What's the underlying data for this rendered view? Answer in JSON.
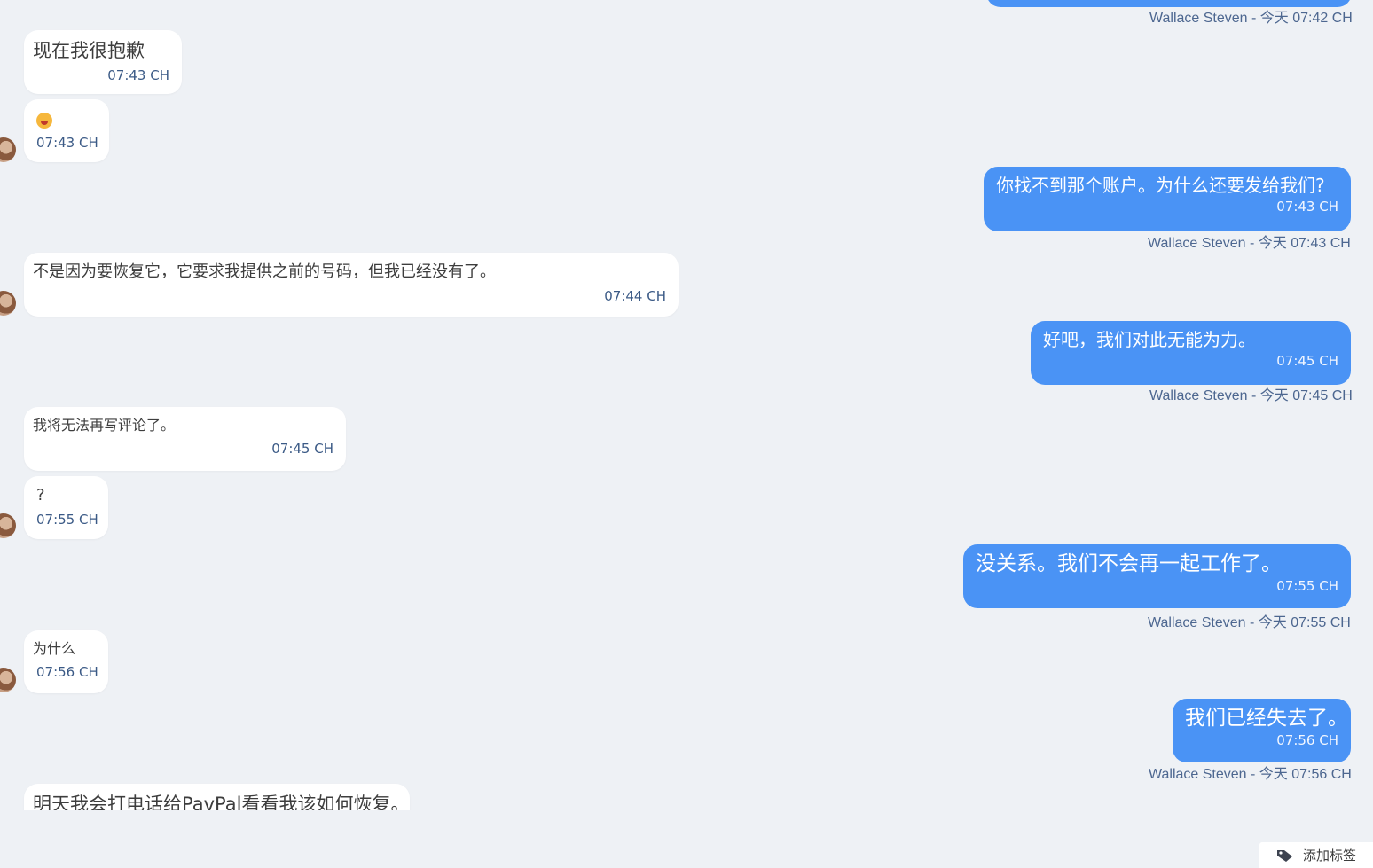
{
  "messages": [
    {
      "id": "m0",
      "direction": "out",
      "meta": "Wallace Steven - 今天 07:42 CH"
    },
    {
      "id": "m1",
      "direction": "in",
      "text": "现在我很抱歉",
      "time": "07:43 CH"
    },
    {
      "id": "m2",
      "direction": "in",
      "emoji": "face-emoji",
      "time": "07:43 CH"
    },
    {
      "id": "m3",
      "direction": "out",
      "text": "你找不到那个账户。为什么还要发给我们?",
      "time": "07:43 CH",
      "meta": "Wallace Steven - 今天 07:43 CH"
    },
    {
      "id": "m4",
      "direction": "in",
      "text": "不是因为要恢复它，它要求我提供之前的号码，但我已经没有了。",
      "time": "07:44 CH"
    },
    {
      "id": "m5",
      "direction": "out",
      "text": "好吧，我们对此无能为力。",
      "time": "07:45 CH",
      "meta": "Wallace Steven - 今天 07:45 CH"
    },
    {
      "id": "m6",
      "direction": "in",
      "text": "我将无法再写评论了。",
      "time": "07:45 CH"
    },
    {
      "id": "m7",
      "direction": "in",
      "text": "?",
      "time": "07:55 CH"
    },
    {
      "id": "m8",
      "direction": "out",
      "text": "没关系。我们不会再一起工作了。",
      "time": "07:55 CH",
      "meta": "Wallace Steven - 今天 07:55 CH"
    },
    {
      "id": "m9",
      "direction": "in",
      "text": "为什么",
      "time": "07:56 CH"
    },
    {
      "id": "m10",
      "direction": "out",
      "text": "我们已经失去了。",
      "time": "07:56 CH",
      "meta": "Wallace Steven - 今天 07:56 CH"
    },
    {
      "id": "m11",
      "direction": "in",
      "text": "明天我会打电话给PavPal看看我该如何恢复。"
    }
  ],
  "footer": {
    "add_tag_label": "添加标签"
  },
  "colors": {
    "outgoing": "#4a93f5",
    "incoming": "#ffffff",
    "background": "#eef1f5",
    "time_text": "#3b5a86"
  }
}
